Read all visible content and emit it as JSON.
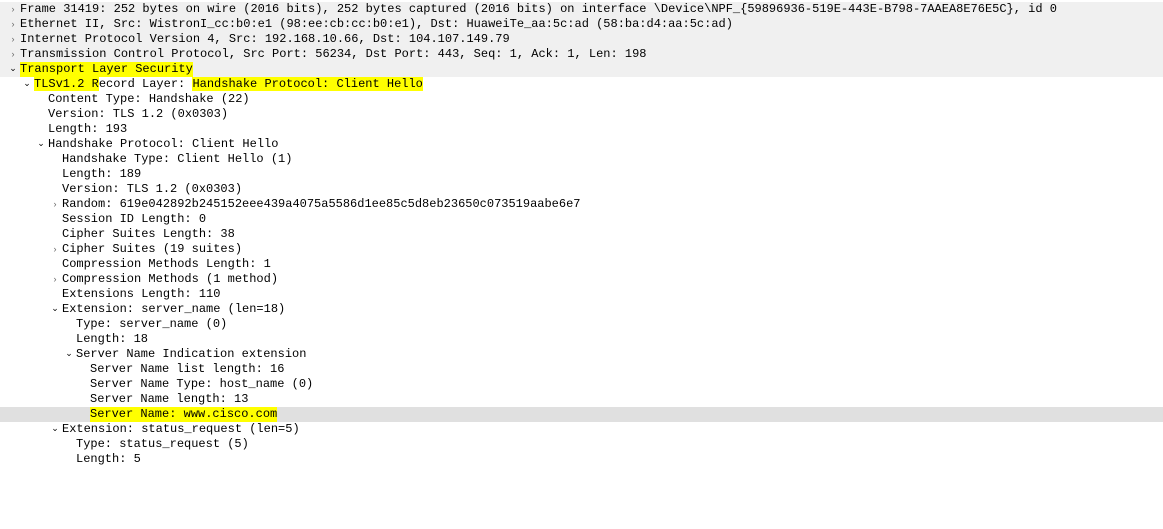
{
  "frame_summary": "Frame 31419: 252 bytes on wire (2016 bits), 252 bytes captured (2016 bits) on interface \\Device\\NPF_{59896936-519E-443E-B798-7AAEA8E76E5C}, id 0",
  "eth_summary": "Ethernet II, Src: WistronI_cc:b0:e1 (98:ee:cb:cc:b0:e1), Dst: HuaweiTe_aa:5c:ad (58:ba:d4:aa:5c:ad)",
  "ip_summary": "Internet Protocol Version 4, Src: 192.168.10.66, Dst: 104.107.149.79",
  "tcp_summary": "Transmission Control Protocol, Src Port: 56234, Dst Port: 443, Seq: 1, Ack: 1, Len: 198",
  "tls_header": "Transport Layer Security",
  "record_prefix": "TLSv1.2 R",
  "record_mid": "ecord Layer: ",
  "record_hl": "Handshake Protocol: Client Hello",
  "content_type": "Content Type: Handshake (22)",
  "rec_version": "Version: TLS 1.2 (0x0303)",
  "rec_length": "Length: 193",
  "hs_header": "Handshake Protocol: Client Hello",
  "hs_type": "Handshake Type: Client Hello (1)",
  "hs_length": "Length: 189",
  "hs_version": "Version: TLS 1.2 (0x0303)",
  "random": "Random: 619e042892b245152eee439a4075a5586d1ee85c5d8eb23650c073519aabe6e7",
  "session_id_len": "Session ID Length: 0",
  "cipher_len": "Cipher Suites Length: 38",
  "cipher_suites": "Cipher Suites (19 suites)",
  "comp_len": "Compression Methods Length: 1",
  "comp_methods": "Compression Methods (1 method)",
  "ext_len": "Extensions Length: 110",
  "ext_sn": "Extension: server_name (len=18)",
  "sn_type": "Type: server_name (0)",
  "sn_length": "Length: 18",
  "sni_header": "Server Name Indication extension",
  "sni_list_len": "Server Name list length: 16",
  "sni_type": "Server Name Type: host_name (0)",
  "sni_name_len": "Server Name length: 13",
  "sni_name": "Server Name: www.cisco.com",
  "ext_status": "Extension: status_request (len=5)",
  "status_type": "Type: status_request (5)",
  "status_length": "Length: 5"
}
